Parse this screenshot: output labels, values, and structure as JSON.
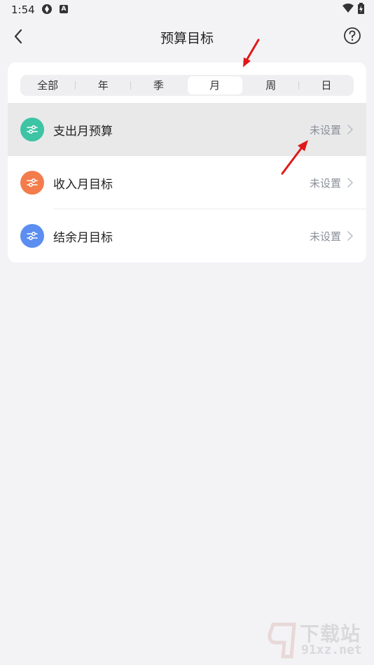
{
  "status_bar": {
    "time": "1:54"
  },
  "header": {
    "title": "预算目标"
  },
  "segments": [
    {
      "label": "全部",
      "active": false
    },
    {
      "label": "年",
      "active": false
    },
    {
      "label": "季",
      "active": false
    },
    {
      "label": "月",
      "active": true
    },
    {
      "label": "周",
      "active": false
    },
    {
      "label": "日",
      "active": false
    }
  ],
  "rows": [
    {
      "label": "支出月预算",
      "status": "未设置",
      "icon_color": "#3cc4a4",
      "highlighted": true
    },
    {
      "label": "收入月目标",
      "status": "未设置",
      "icon_color": "#f47c4c",
      "highlighted": false
    },
    {
      "label": "结余月目标",
      "status": "未设置",
      "icon_color": "#5b8ef0",
      "highlighted": false
    }
  ],
  "watermark": {
    "line1": "下载站",
    "line2": "91xz.net"
  },
  "colors": {
    "annotation_arrow": "#e01818",
    "background": "#f3f3f6"
  }
}
